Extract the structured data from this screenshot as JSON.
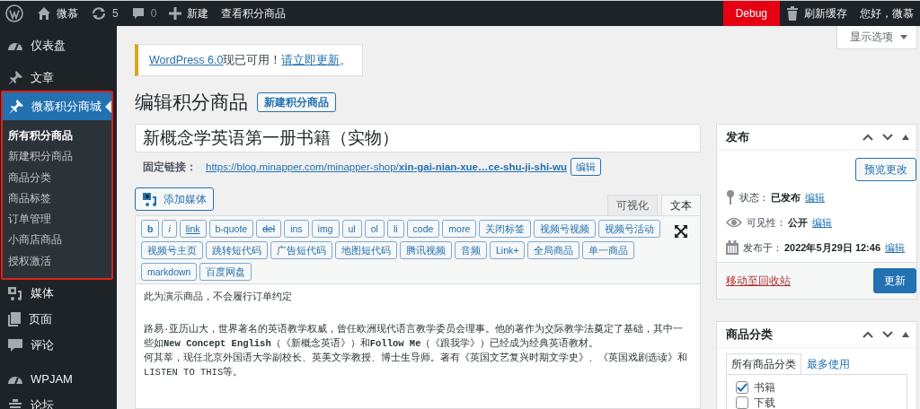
{
  "admin_bar": {
    "left": [
      {
        "kind": "logo"
      },
      {
        "kind": "site",
        "label": "微慕"
      },
      {
        "kind": "updates",
        "label": "5"
      },
      {
        "kind": "comments",
        "label": "0"
      },
      {
        "kind": "new",
        "label": "新建"
      },
      {
        "kind": "link",
        "label": "查看积分商品"
      }
    ],
    "right": [
      {
        "kind": "debug",
        "label": "Debug"
      },
      {
        "kind": "cache",
        "label": "刷新缓存"
      },
      {
        "kind": "account",
        "label": "您好，微慕"
      }
    ]
  },
  "sidebar": {
    "items": [
      {
        "kind": "dashboard",
        "label": "仪表盘",
        "selected": false,
        "highlighted": false
      },
      {
        "kind": "pin",
        "label": "文章",
        "selected": false,
        "highlighted": false
      },
      {
        "kind": "pin",
        "label": "微慕积分商城",
        "selected": true,
        "highlighted": true,
        "children": [
          {
            "label": "所有积分商品",
            "selected": true
          },
          {
            "label": "新建积分商品",
            "selected": false
          },
          {
            "label": "商品分类",
            "selected": false
          },
          {
            "label": "商品标签",
            "selected": false
          },
          {
            "label": "订单管理",
            "selected": false
          },
          {
            "label": "小商店商品",
            "selected": false
          },
          {
            "label": "授权激活",
            "selected": false
          }
        ]
      },
      {
        "kind": "media",
        "label": "媒体",
        "selected": false,
        "highlighted": false
      },
      {
        "kind": "page",
        "label": "页面",
        "selected": false,
        "highlighted": false
      },
      {
        "kind": "comment",
        "label": "评论",
        "selected": false,
        "highlighted": false
      },
      {
        "kind": "gauge",
        "label": "WPJAM",
        "selected": false,
        "highlighted": false
      },
      {
        "kind": "forum",
        "label": "论坛",
        "selected": false,
        "highlighted": false
      }
    ]
  },
  "screen_options": {
    "label": "显示选项"
  },
  "notice": {
    "parts": [
      {
        "kind": "link",
        "text": "WordPress 6.0"
      },
      {
        "kind": "text",
        "text": "现已可用！"
      },
      {
        "kind": "link",
        "text": "请立即更新"
      },
      {
        "kind": "text",
        "text": "。"
      }
    ]
  },
  "heading": {
    "title": "编辑积分商品",
    "add_button": "新建积分商品"
  },
  "title_field": {
    "value": "新概念学英语第一册书籍（实物）"
  },
  "permalink": {
    "label": "固定链接：",
    "url": "https://blog.minapper.com/minapper-shop/**xin-gai-nian-xue…ce-shu-ji-shi-wu**",
    "edit_button": "编辑"
  },
  "editor": {
    "add_media": "添加媒体",
    "tabs": [
      {
        "label": "可视化",
        "selected": false
      },
      {
        "label": "文本",
        "selected": true
      }
    ],
    "quicktags": [
      {
        "label": "b",
        "kind": "bold"
      },
      {
        "label": "i",
        "kind": "italic"
      },
      {
        "label": "link",
        "kind": "underline"
      },
      {
        "label": "b-quote",
        "kind": "plain"
      },
      {
        "label": "del",
        "kind": "strike"
      },
      {
        "label": "ins",
        "kind": "plain"
      },
      {
        "label": "img",
        "kind": "plain"
      },
      {
        "label": "ul",
        "kind": "plain"
      },
      {
        "label": "ol",
        "kind": "plain"
      },
      {
        "label": "li",
        "kind": "plain"
      },
      {
        "label": "code",
        "kind": "plain"
      },
      {
        "label": "more",
        "kind": "plain"
      },
      {
        "label": "关闭标签",
        "kind": "plain"
      },
      {
        "label": "视频号视频",
        "kind": "plain"
      },
      {
        "label": "视频号活动",
        "kind": "plain"
      },
      {
        "label": "视频号主页",
        "kind": "plain"
      },
      {
        "label": "跳转短代码",
        "kind": "plain"
      },
      {
        "label": "广告短代码",
        "kind": "plain"
      },
      {
        "label": "地图短代码",
        "kind": "plain"
      },
      {
        "label": "腾讯视频",
        "kind": "plain"
      },
      {
        "label": "音频",
        "kind": "plain"
      },
      {
        "label": "Link+",
        "kind": "plain"
      },
      {
        "label": "全局商品",
        "kind": "plain"
      },
      {
        "label": "单一商品",
        "kind": "plain"
      },
      {
        "label": "markdown",
        "kind": "plain"
      },
      {
        "label": "百度网盘",
        "kind": "plain"
      }
    ],
    "content": [
      "此为演示商品，不会履行订单约定",
      "路易·亚历山大，世界著名的英语教学权威，曾任欧洲现代语言教学委员会理事。他的著作为交际教学法奠定了基础，其中一些如**New Concept English**（《新概念英语》）和**Follow Me**（《跟我学》）已经成为经典英语教材。",
      "何其莘，现任北京外国语大学副校长、英美文学教授、博士生导师。著有《英国文艺复兴时期文学史》、《英国戏剧选读》和LISTEN TO THIS等。"
    ]
  },
  "publish_box": {
    "title": "发布",
    "preview_button": "预览更改",
    "rows": [
      {
        "kind": "status",
        "label": "状态：",
        "value": "已发布",
        "link": "编辑"
      },
      {
        "kind": "visibility",
        "label": "可见性：",
        "value": "公开",
        "link": "编辑"
      },
      {
        "kind": "date",
        "label": "发布于：",
        "value": "2022年5月29日 12:46",
        "link": "编辑"
      }
    ],
    "trash_link": "移动至回收站",
    "update_button": "更新"
  },
  "category_box": {
    "title": "商品分类",
    "tabs": [
      {
        "label": "所有商品分类",
        "selected": true
      },
      {
        "label": "最多使用",
        "selected": false
      }
    ],
    "items": [
      {
        "label": "书籍",
        "checked": true
      },
      {
        "label": "下载",
        "checked": false
      }
    ]
  }
}
